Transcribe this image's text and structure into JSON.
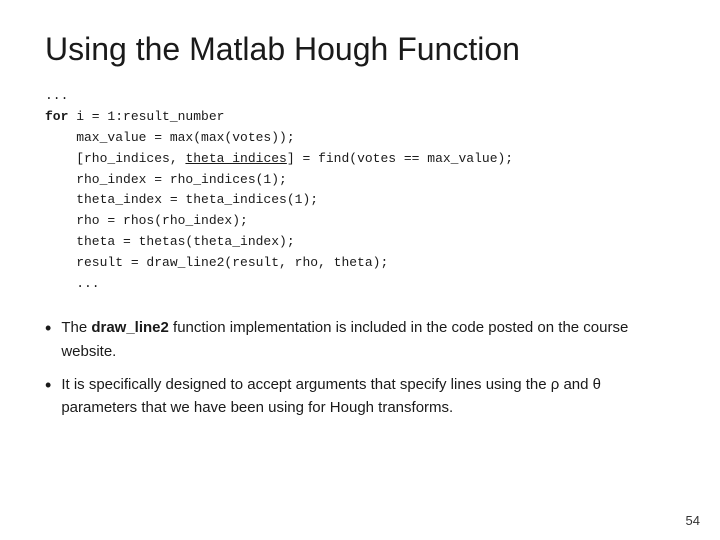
{
  "slide": {
    "title": "Using the Matlab Hough Function",
    "code": {
      "lines": [
        {
          "text": "...",
          "indent": 0
        },
        {
          "text": "for i = 1:result_number",
          "indent": 0,
          "keyword": "for"
        },
        {
          "text": "    max_value = max(max(votes));",
          "indent": 0
        },
        {
          "text": "    [rho_indices, theta_indices] = find(votes == max_value);",
          "indent": 0,
          "underline": "theta_indices"
        },
        {
          "text": "    rho_index = rho_indices(1);",
          "indent": 0
        },
        {
          "text": "    theta_index = theta_indices(1);",
          "indent": 0
        },
        {
          "text": "    rho = rhos(rho_index);",
          "indent": 0
        },
        {
          "text": "    theta = thetas(theta_index);",
          "indent": 0
        },
        {
          "text": "    result = draw_line2(result, rho, theta);",
          "indent": 0
        },
        {
          "text": "    ...",
          "indent": 0
        }
      ]
    },
    "bullets": [
      {
        "text_before": "The ",
        "bold": "draw_line2",
        "text_after": " function implementation is included in the code posted on the course website."
      },
      {
        "text_before": "It is specifically designed to accept arguments that specify lines using the ρ and θ parameters that we have been using for Hough transforms.",
        "bold": "",
        "text_after": ""
      }
    ],
    "page_number": "54"
  }
}
